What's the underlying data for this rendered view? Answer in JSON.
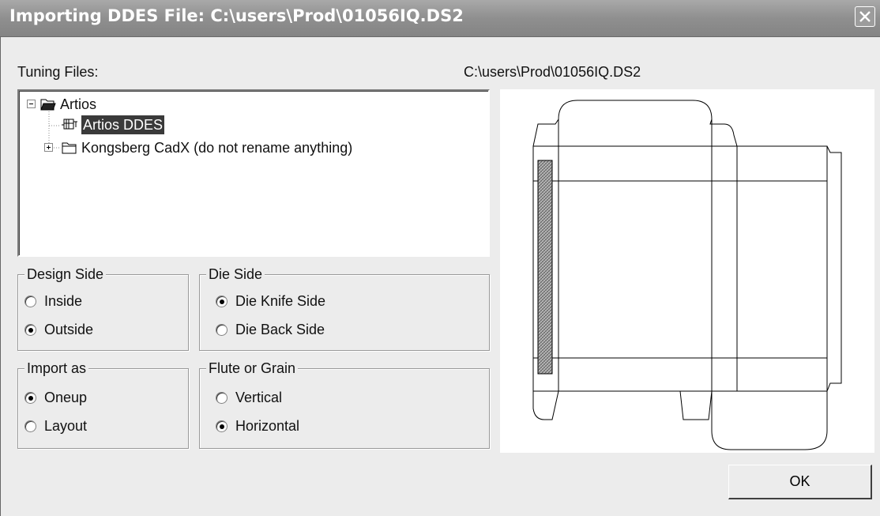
{
  "window": {
    "title": "Importing DDES File: C:\\users\\Prod\\01056IQ.DS2",
    "close_icon": "close-icon"
  },
  "tuning_files": {
    "label": "Tuning Files:",
    "tree": [
      {
        "label": "Artios",
        "icon": "folder-open-icon",
        "expander": "minus",
        "level": 0
      },
      {
        "label": "Artios DDES",
        "icon": "tuning-file-icon",
        "level": 1,
        "selected": true
      },
      {
        "label": "Kongsberg CadX (do not rename anything)",
        "icon": "folder-icon",
        "expander": "plus",
        "level": 1
      }
    ]
  },
  "preview": {
    "path": "C:\\users\\Prod\\01056IQ.DS2"
  },
  "design_side": {
    "legend": "Design Side",
    "options": [
      {
        "label": "Inside",
        "checked": false
      },
      {
        "label": "Outside",
        "checked": true
      }
    ]
  },
  "die_side": {
    "legend": "Die Side",
    "options": [
      {
        "label": "Die Knife Side",
        "checked": true
      },
      {
        "label": "Die Back Side",
        "checked": false
      }
    ]
  },
  "import_as": {
    "legend": "Import as",
    "options": [
      {
        "label": "Oneup",
        "checked": true
      },
      {
        "label": "Layout",
        "checked": false
      }
    ]
  },
  "flute_grain": {
    "legend": "Flute or Grain",
    "options": [
      {
        "label": "Vertical",
        "checked": false
      },
      {
        "label": "Horizontal",
        "checked": true
      }
    ]
  },
  "buttons": {
    "ok": "OK"
  }
}
